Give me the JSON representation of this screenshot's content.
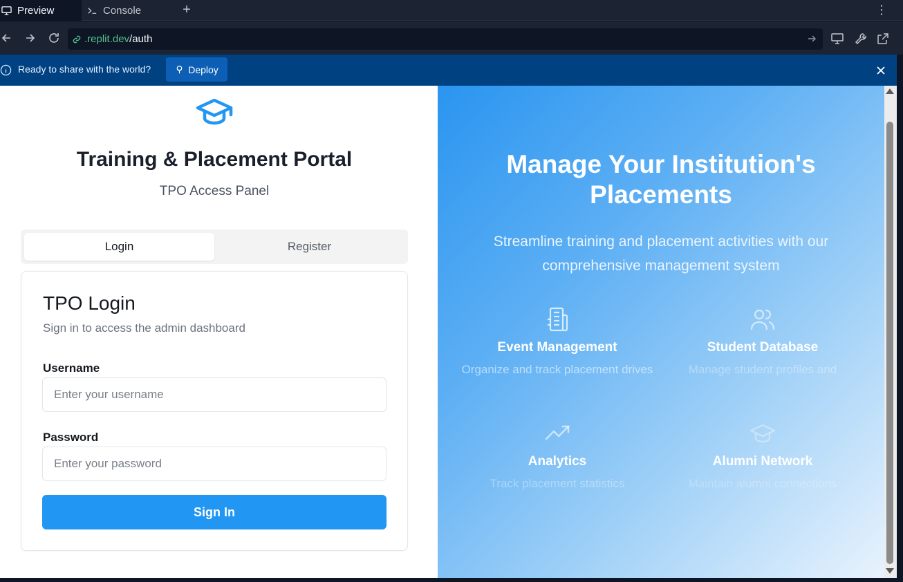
{
  "tabs": {
    "preview_label": "Preview",
    "console_label": "Console",
    "add_icon": "plus-icon",
    "more_icon": "kebab-menu-icon"
  },
  "addressbar": {
    "url_host": ".replit.dev",
    "url_path": "/auth"
  },
  "banner": {
    "text": "Ready to share with the world?",
    "deploy_label": "Deploy"
  },
  "login_page": {
    "title": "Training & Placement Portal",
    "subtitle": "TPO Access Panel",
    "tabs": [
      "Login",
      "Register"
    ],
    "active_tab": "Login",
    "card": {
      "title": "TPO Login",
      "subtitle": "Sign in to access the admin dashboard",
      "username_label": "Username",
      "username_placeholder": "Enter your username",
      "password_label": "Password",
      "password_placeholder": "Enter your password",
      "submit_label": "Sign In"
    }
  },
  "hero": {
    "title": "Manage Your Institution's Placements",
    "subtitle": "Streamline training and placement activities with our comprehensive management system",
    "features": [
      {
        "icon": "building-icon",
        "title": "Event Management",
        "desc": "Organize and track placement drives"
      },
      {
        "icon": "users-icon",
        "title": "Student Database",
        "desc": "Manage student profiles and"
      },
      {
        "icon": "trending-up-icon",
        "title": "Analytics",
        "desc": "Track placement statistics"
      },
      {
        "icon": "graduation-cap-icon",
        "title": "Alumni Network",
        "desc": "Maintain alumni connections"
      }
    ]
  },
  "colors": {
    "primary": "#2196f3",
    "banner": "#004182",
    "ide_bg": "#1c2333"
  }
}
